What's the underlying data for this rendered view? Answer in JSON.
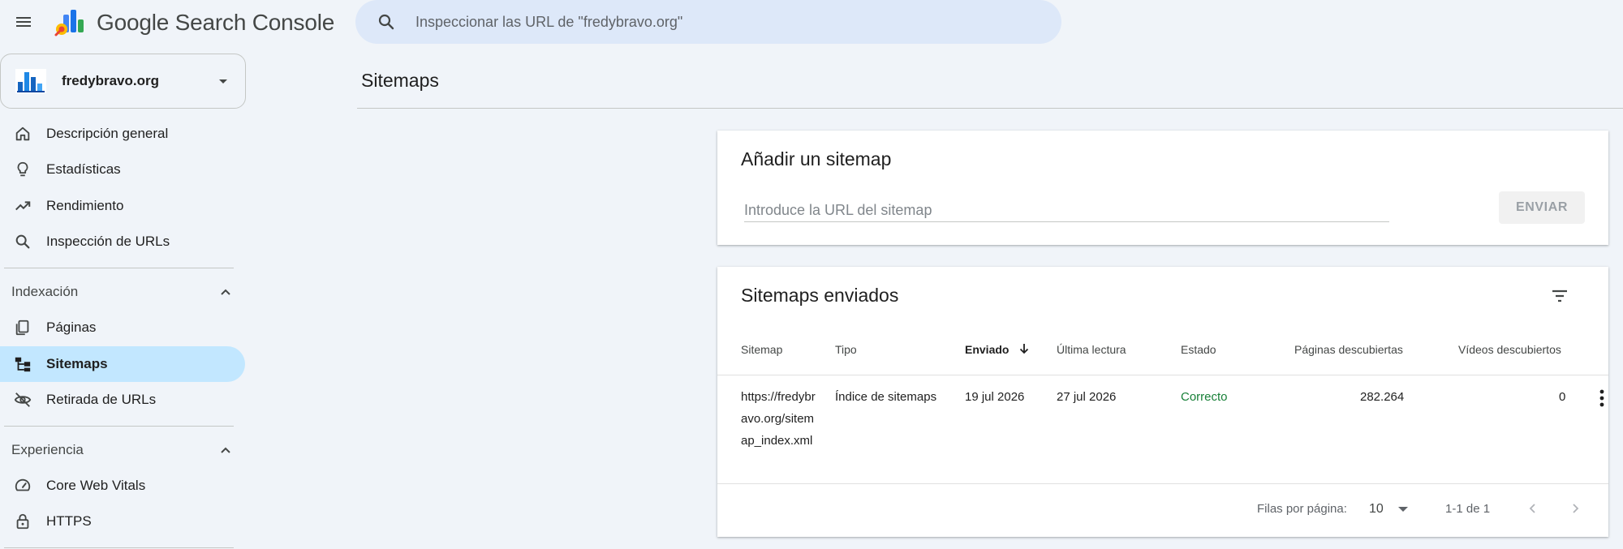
{
  "header": {
    "app_name": "Google Search Console",
    "search_placeholder": "Inspeccionar las URL de \"fredybravo.org\""
  },
  "property": {
    "name": "fredybravo.org"
  },
  "sidebar": {
    "items": [
      {
        "label": "Descripción general",
        "icon": "home-icon"
      },
      {
        "label": "Estadísticas",
        "icon": "lightbulb-icon"
      },
      {
        "label": "Rendimiento",
        "icon": "trending-up-icon"
      },
      {
        "label": "Inspección de URLs",
        "icon": "search-icon"
      }
    ],
    "sections": [
      {
        "label": "Indexación",
        "items": [
          {
            "label": "Páginas",
            "icon": "pages-icon"
          },
          {
            "label": "Sitemaps",
            "icon": "sitemap-icon",
            "active": true
          },
          {
            "label": "Retirada de URLs",
            "icon": "eye-off-icon"
          }
        ]
      },
      {
        "label": "Experiencia",
        "items": [
          {
            "label": "Core Web Vitals",
            "icon": "speedometer-icon"
          },
          {
            "label": "HTTPS",
            "icon": "lock-icon"
          }
        ]
      }
    ]
  },
  "main": {
    "title": "Sitemaps",
    "add_card": {
      "title": "Añadir un sitemap",
      "input_placeholder": "Introduce la URL del sitemap",
      "submit_label": "ENVIAR"
    },
    "list_card": {
      "title": "Sitemaps enviados",
      "columns": [
        "Sitemap",
        "Tipo",
        "Enviado",
        "Última lectura",
        "Estado",
        "Páginas descubiertas",
        "Vídeos descubiertos"
      ],
      "sorted_column": "Enviado",
      "rows": [
        {
          "sitemap": "https://fredybravo.org/sitemap_index.xml",
          "type": "Índice de sitemaps",
          "submitted": "19 jul 2026",
          "last_read": "27 jul 2026",
          "status": "Correcto",
          "pages": "282.264",
          "videos": "0"
        }
      ],
      "pagination": {
        "rows_per_page_label": "Filas por página:",
        "rows_per_page": "10",
        "range": "1-1 de 1"
      }
    }
  },
  "colors": {
    "background": "#f0f4f9",
    "active_nav": "#c2e7ff",
    "search_bg": "#dde8f9",
    "status_ok": "#188038"
  }
}
